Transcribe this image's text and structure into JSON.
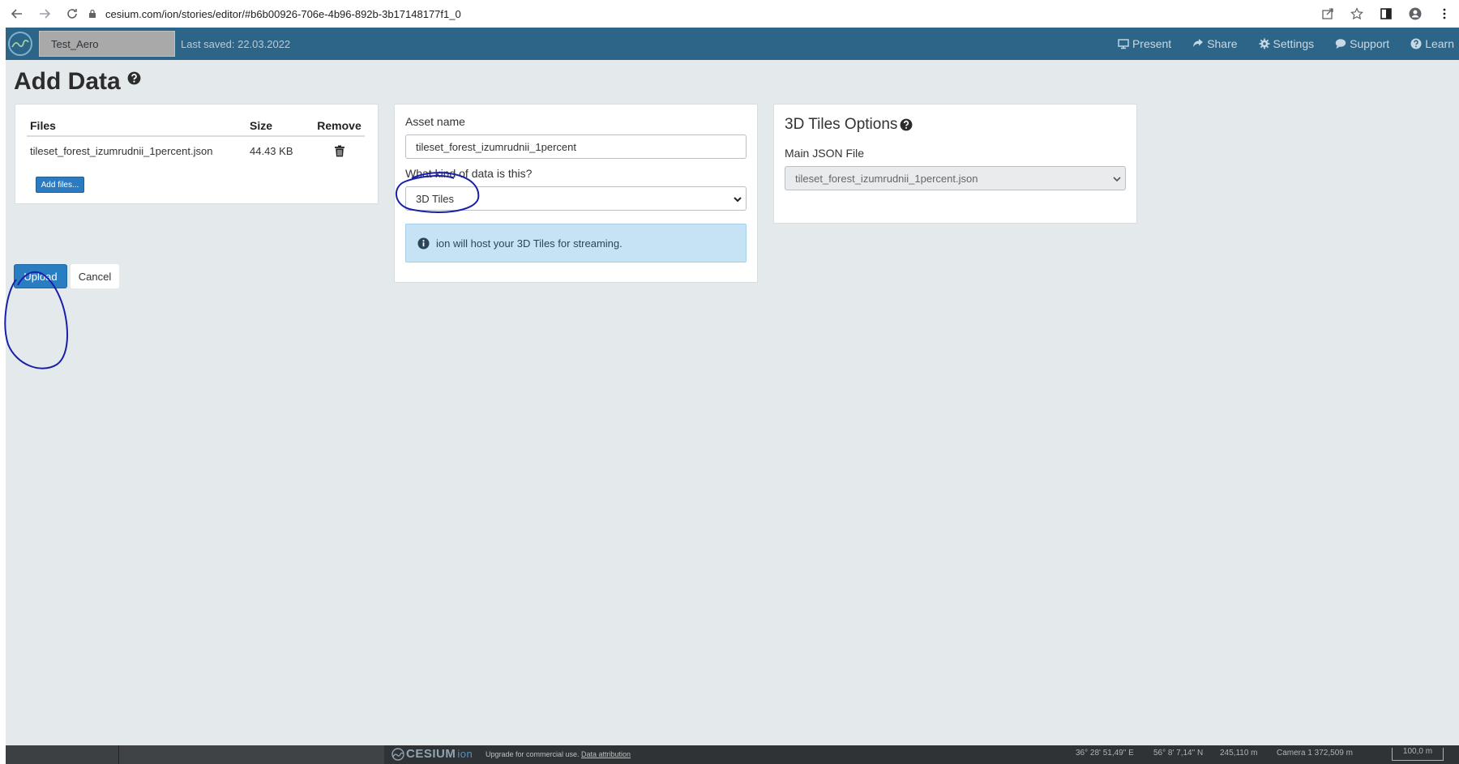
{
  "browser": {
    "url": "cesium.com/ion/stories/editor/#b6b00926-706e-4b96-892b-3b17148177f1_0"
  },
  "header": {
    "story_title": "Test_Aero",
    "last_saved": "Last saved: 22.03.2022",
    "menu": [
      {
        "label": "Present",
        "icon": "monitor-icon"
      },
      {
        "label": "Share",
        "icon": "share-icon"
      },
      {
        "label": "Settings",
        "icon": "gear-icon"
      },
      {
        "label": "Support",
        "icon": "chat-icon"
      },
      {
        "label": "Learn",
        "icon": "help-icon"
      }
    ]
  },
  "page": {
    "title": "Add Data"
  },
  "files_panel": {
    "columns": [
      "Files",
      "Size",
      "Remove"
    ],
    "rows": [
      {
        "file": "tileset_forest_izumrudnii_1percent.json",
        "size": "44.43 KB"
      }
    ],
    "add_files_label": "Add files..."
  },
  "asset_panel": {
    "asset_name_label": "Asset name",
    "asset_name_value": "tileset_forest_izumrudnii_1percent",
    "data_kind_label": "What kind of data is this?",
    "data_kind_value": "3D Tiles",
    "info_text": "ion will host your 3D Tiles for streaming."
  },
  "options_panel": {
    "title": "3D Tiles Options",
    "main_json_label": "Main JSON File",
    "main_json_value": "tileset_forest_izumrudnii_1percent.json"
  },
  "actions": {
    "upload_label": "Upload",
    "cancel_label": "Cancel"
  },
  "footer": {
    "brand": "CESIUM",
    "brand_suffix": "ion",
    "upgrade_text": "Upgrade for commercial use.",
    "attribution_text": "Data attribution",
    "longitude": "36° 28' 51,49\" E",
    "latitude": "56° 8' 7,14\" N",
    "height": "245,110 m",
    "camera": "Camera 1 372,509 m",
    "scale": "100,0 m"
  },
  "colors": {
    "header_bg": "#2d6588",
    "app_bg": "#e4e9ec",
    "primary_button": "#2b7dc1",
    "info_bg": "#c5e3f4",
    "annotation_ink": "#1a1fa8"
  }
}
